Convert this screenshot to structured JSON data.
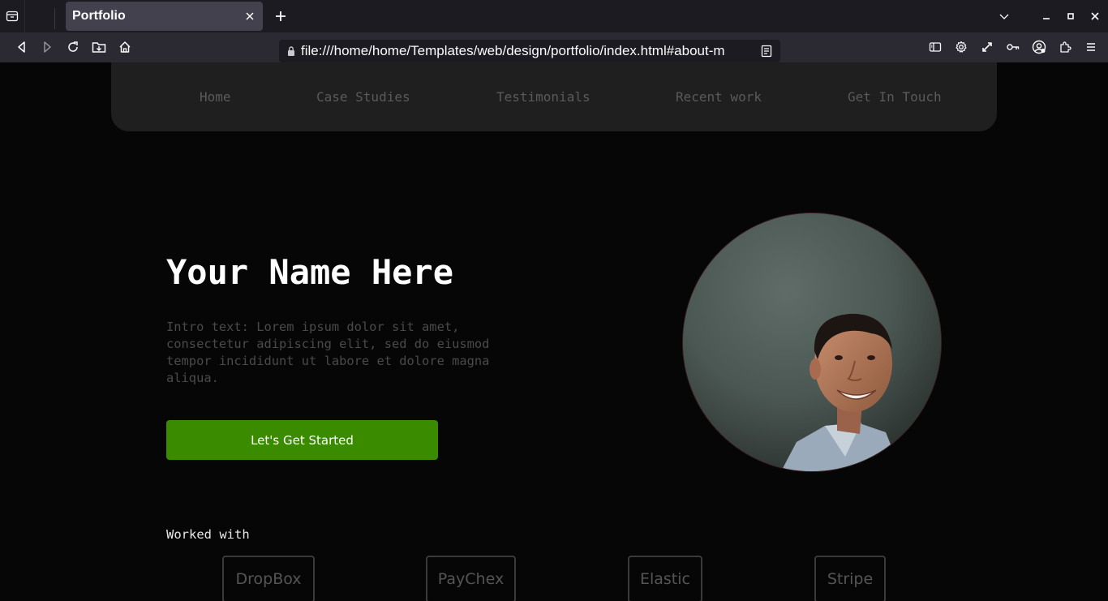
{
  "browser": {
    "tab_title": "Portfolio",
    "url": "file:///home/home/Templates/web/design/portfolio/index.html#about-m"
  },
  "site": {
    "nav": [
      "Home",
      "Case Studies",
      "Testimonials",
      "Recent work",
      "Get In Touch"
    ],
    "hero": {
      "name": "Your Name Here",
      "intro": "Intro text: Lorem ipsum dolor sit amet, consectetur adipiscing elit, sed do eiusmod tempor incididunt ut labore et dolore magna aliqua.",
      "cta_label": "Let's Get Started"
    },
    "worked_with": {
      "heading": "Worked with",
      "companies": [
        "DropBox",
        "PayChex",
        "Elastic",
        "Stripe"
      ]
    }
  },
  "colors": {
    "page_bg": "#060606",
    "nav_bg": "#1f1f1f",
    "cta_bg": "#3a8b00"
  }
}
